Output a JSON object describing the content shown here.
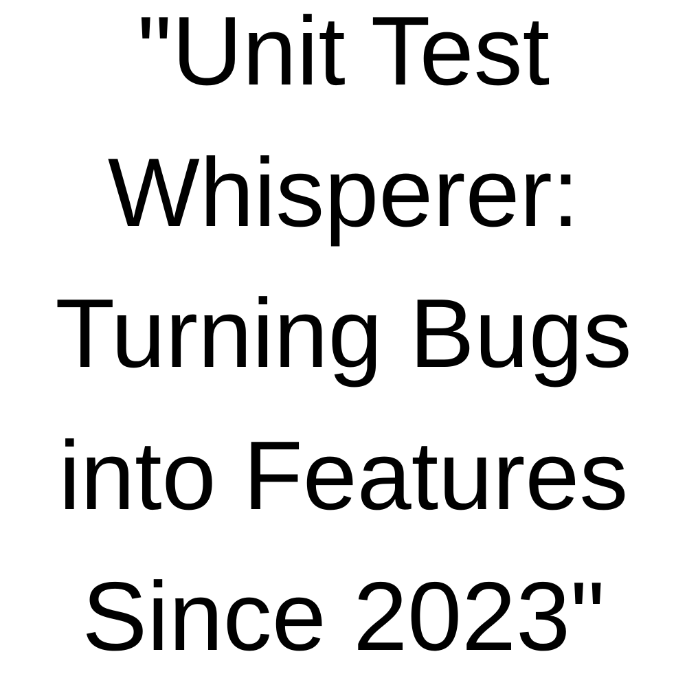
{
  "text_color": "#000000",
  "background_color": "#ffffff",
  "quote": {
    "lines": [
      "\"Unit Test",
      "Whisperer:",
      "Turning Bugs",
      "into Features",
      "Since 2023\""
    ]
  }
}
